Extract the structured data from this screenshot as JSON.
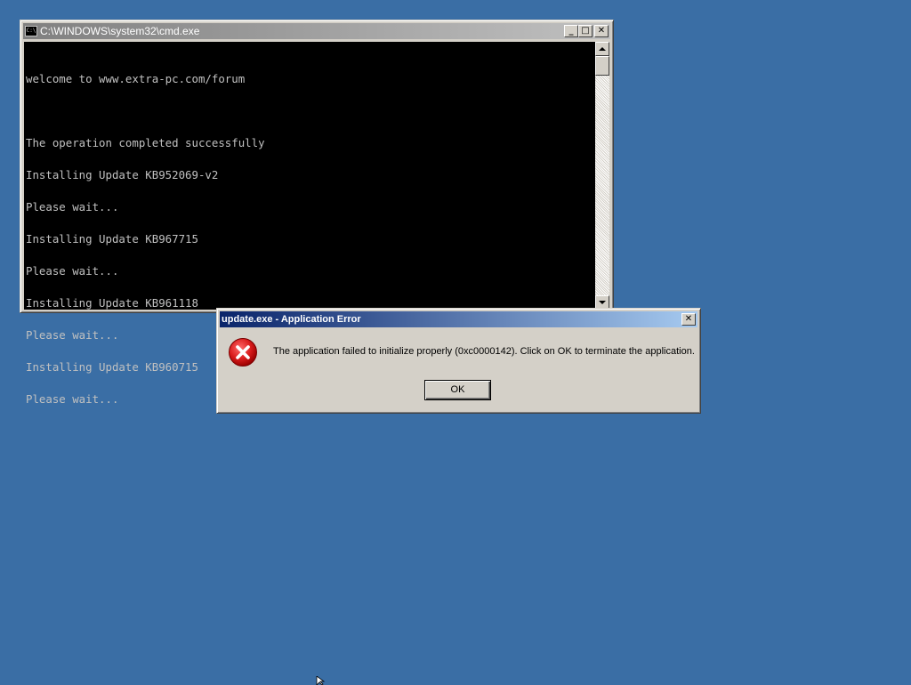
{
  "cmd_window": {
    "title": "C:\\WINDOWS\\system32\\cmd.exe",
    "icon_text": "C:\\",
    "icon": "console-icon",
    "buttons": {
      "minimize": "_",
      "maximize": "□",
      "close": "✕"
    },
    "lines": [
      "welcome to www.extra-pc.com/forum",
      "",
      "The operation completed successfully",
      "Installing Update KB952069-v2",
      "Please wait...",
      "Installing Update KB967715",
      "Please wait...",
      "Installing Update KB961118",
      "Please wait...",
      "Installing Update KB960715",
      "Please wait..."
    ]
  },
  "error_dialog": {
    "title": "update.exe - Application Error",
    "icon": "error-icon",
    "message": "The application failed to initialize properly (0xc0000142). Click on OK to terminate the application.",
    "ok_label": "OK",
    "close_glyph": "✕"
  },
  "colors": {
    "desktop": "#3a6ea5",
    "active_title": "#0a246a",
    "inactive_title": "#808080",
    "console_bg": "#000000",
    "console_fg": "#c0c0c0"
  }
}
